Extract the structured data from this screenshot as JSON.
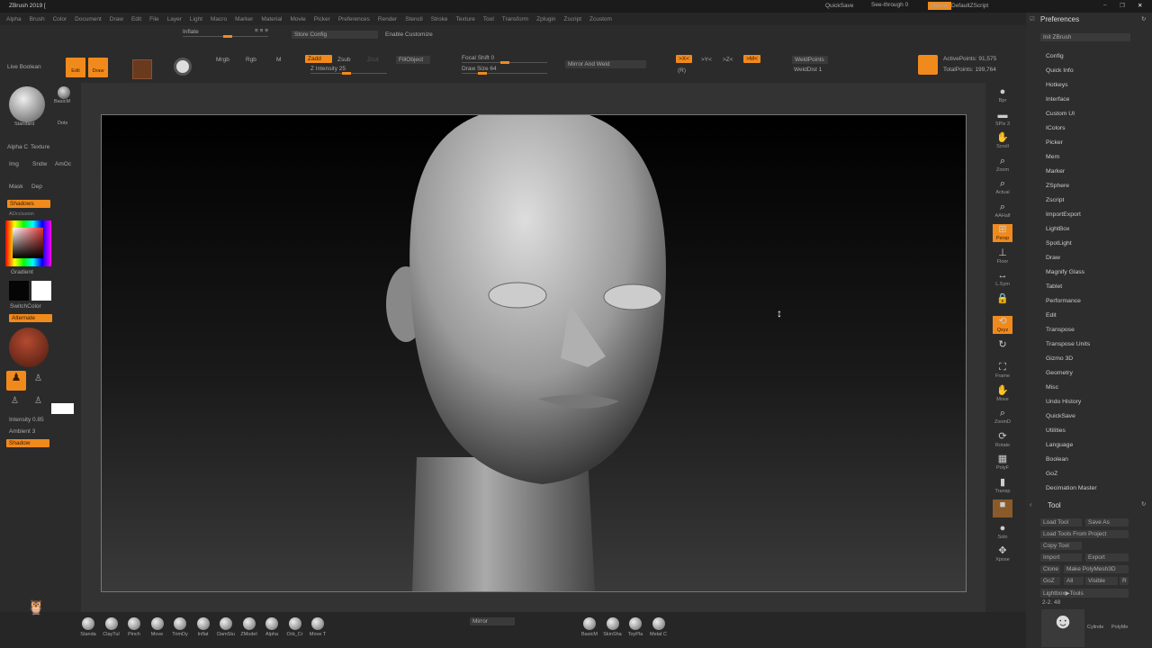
{
  "title": "ZBrush 2019 [",
  "menu": [
    "Alpha",
    "Brush",
    "Color",
    "Document",
    "Draw",
    "Edit",
    "File",
    "Layer",
    "Light",
    "Macro",
    "Marker",
    "Material",
    "Movie",
    "Picker",
    "Preferences",
    "Render",
    "Stencil",
    "Stroke",
    "Texture",
    "Tool",
    "Transform",
    "Zplugin",
    "Zscript",
    "Zcustom"
  ],
  "topright": {
    "quicksave": "QuickSave",
    "see_through": "See-through  0",
    "menus": "Menus",
    "script": "DefaultZScript"
  },
  "shelf": {
    "inflate": "Inflate",
    "inflate_val": "≡ ≡ ≡",
    "store_config": "Store Config",
    "enable_customize": "Enable Customize",
    "live_boolean": "Live Boolean",
    "edit": "Edit",
    "draw": "Draw",
    "mrgb": "Mrgb",
    "rgb": "Rgb",
    "m": "M",
    "zadd": "Zadd",
    "zsub": "Zsub",
    "zcut": "Zcut",
    "fill_object": "FillObject",
    "z_intensity": "Z Intensity 25",
    "focal_shift": "Focal Shift 0",
    "draw_size": "Draw Size 64",
    "mirror_weld": "Mirror And Weld",
    "x": ">X<",
    "y": ">Y<",
    "z": ">Z<",
    "m2": ">M<",
    "r": "(R)",
    "weld_points": "WeldPoints",
    "weld_dist": "WeldDist 1",
    "active_points": "ActivePoints: 91,575",
    "total_points": "TotalPoints: 199,764"
  },
  "left": {
    "standard": "Standard",
    "basic": "BasicM",
    "dots": "Dots",
    "alpha": "Alpha C",
    "texture": "Texture",
    "img": "Img",
    "sndw": "Sndw",
    "amoc": "AmOc",
    "mask": "Mask",
    "dep": "Dep",
    "shadows": "Shadows",
    "ambient_occ": "AOcclusion",
    "gradient": "Gradient",
    "switch_color": "SwitchColor",
    "alternate": "Alternate",
    "intensity": "Intensity 0.85",
    "ambient": "Ambient 3",
    "shadow": "Shadow"
  },
  "rshelf": [
    "Bpr",
    "SPix 3",
    "Scroll",
    "Zoom",
    "Actual",
    "AAHalf",
    "Persp",
    "Floor",
    "L.Sym",
    "",
    "Qxyz",
    "",
    "Frame",
    "Move",
    "ZoomD",
    "Rotate",
    "PolyF",
    "Transp",
    "",
    "Solo",
    "Xpose"
  ],
  "prefs": {
    "title": "Preferences",
    "init": "Init ZBrush",
    "items": [
      "Config",
      "Quick Info",
      "Hotkeys",
      "Interface",
      "Custom UI",
      "IColors",
      "Picker",
      "Mem",
      "Marker",
      "ZSphere",
      "Zscript",
      "ImportExport",
      "LightBox",
      "SpotLight",
      "Draw",
      "Magnify Glass",
      "Tablet",
      "Performance",
      "Edit",
      "Transpose",
      "Transpose Units",
      "Gizmo 3D",
      "Geometry",
      "Misc",
      "Undo History",
      "QuickSave",
      "Utilities",
      "Language",
      "Boolean",
      "GoZ",
      "Decimation Master"
    ]
  },
  "tool": {
    "title": "Tool",
    "load": "Load Tool",
    "save_as": "Save As",
    "load_project": "Load Tools From Project",
    "copy": "Copy Tool",
    "import": "Import",
    "export": "Export",
    "clone": "Clone",
    "make_polymesh": "Make PolyMesh3D",
    "goz": "GoZ",
    "all": "All",
    "visible": "Visible",
    "r": "R",
    "lightbox_tools": "Lightbox▶Tools",
    "count": "2-2. 48",
    "cylinder": "Cylinde",
    "polymesh": "PolyMe"
  },
  "bottom": {
    "brushes": [
      "Standa",
      "ClayTul",
      "Pinch",
      "Move",
      "TrimDy",
      "Inflat",
      "DamStu",
      "ZModel",
      "Alpha",
      "Orb_Cr",
      "Move T"
    ],
    "mirror": "Mirror",
    "materials": [
      "BasicM",
      "SkinSha",
      "ToyPla",
      "Metal C"
    ]
  }
}
